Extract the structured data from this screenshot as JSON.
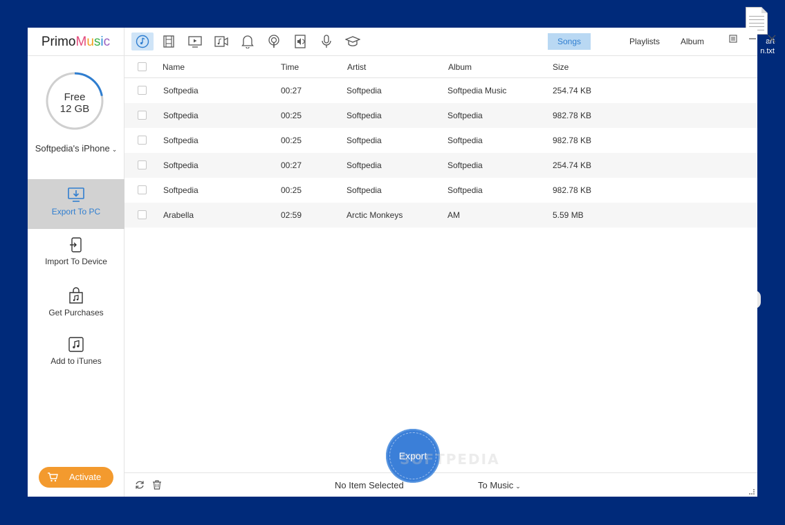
{
  "app": {
    "logo": {
      "part1": "Primo",
      "m": "M",
      "u": "u",
      "s": "s",
      "i": "i",
      "c": "c"
    }
  },
  "desktop": {
    "file_label": "art\nn.txt"
  },
  "sidebar": {
    "storage": {
      "free_label": "Free",
      "free_value": "12 GB",
      "used_fraction": 0.22
    },
    "device_name": "Softpedia's iPhone",
    "items": [
      {
        "label": "Export To PC",
        "icon": "export-to-pc-icon",
        "active": true
      },
      {
        "label": "Import To Device",
        "icon": "import-to-device-icon",
        "active": false
      },
      {
        "label": "Get Purchases",
        "icon": "shopping-bag-icon",
        "active": false
      },
      {
        "label": "Add to iTunes",
        "icon": "itunes-note-icon",
        "active": false
      }
    ],
    "activate_label": "Activate"
  },
  "toolbar": {
    "categories": [
      {
        "icon": "music-icon",
        "active": true
      },
      {
        "icon": "film-icon",
        "active": false
      },
      {
        "icon": "tv-icon",
        "active": false
      },
      {
        "icon": "music-video-icon",
        "active": false
      },
      {
        "icon": "bell-icon",
        "active": false
      },
      {
        "icon": "podcast-icon",
        "active": false
      },
      {
        "icon": "audiobook-icon",
        "active": false
      },
      {
        "icon": "microphone-icon",
        "active": false
      },
      {
        "icon": "graduation-cap-icon",
        "active": false
      }
    ],
    "view_tabs": [
      {
        "label": "Songs",
        "active": true
      },
      {
        "label": "Playlists",
        "active": false
      },
      {
        "label": "Album",
        "active": false
      }
    ]
  },
  "table": {
    "columns": {
      "name": "Name",
      "time": "Time",
      "artist": "Artist",
      "album": "Album",
      "size": "Size"
    },
    "rows": [
      {
        "name": "Softpedia",
        "time": "00:27",
        "artist": "Softpedia",
        "album": "Softpedia Music",
        "size": "254.74 KB"
      },
      {
        "name": "Softpedia",
        "time": "00:25",
        "artist": "Softpedia",
        "album": "Softpedia",
        "size": "982.78 KB"
      },
      {
        "name": "Softpedia",
        "time": "00:25",
        "artist": "Softpedia",
        "album": "Softpedia",
        "size": "982.78 KB"
      },
      {
        "name": "Softpedia",
        "time": "00:27",
        "artist": "Softpedia",
        "album": "Softpedia",
        "size": "254.74 KB"
      },
      {
        "name": "Softpedia",
        "time": "00:25",
        "artist": "Softpedia",
        "album": "Softpedia",
        "size": "982.78 KB"
      },
      {
        "name": "Arabella",
        "time": "02:59",
        "artist": "Arctic Monkeys",
        "album": "AM",
        "size": "5.59 MB"
      }
    ]
  },
  "footer": {
    "selection_status": "No Item Selected",
    "export_label": "Export",
    "destination": "To Music",
    "watermark": "SOFTPEDIA"
  },
  "colors": {
    "accent": "#2f7ed0",
    "activate": "#f39a2e",
    "export": "#3b7fd8",
    "desktop": "#002a7a"
  }
}
